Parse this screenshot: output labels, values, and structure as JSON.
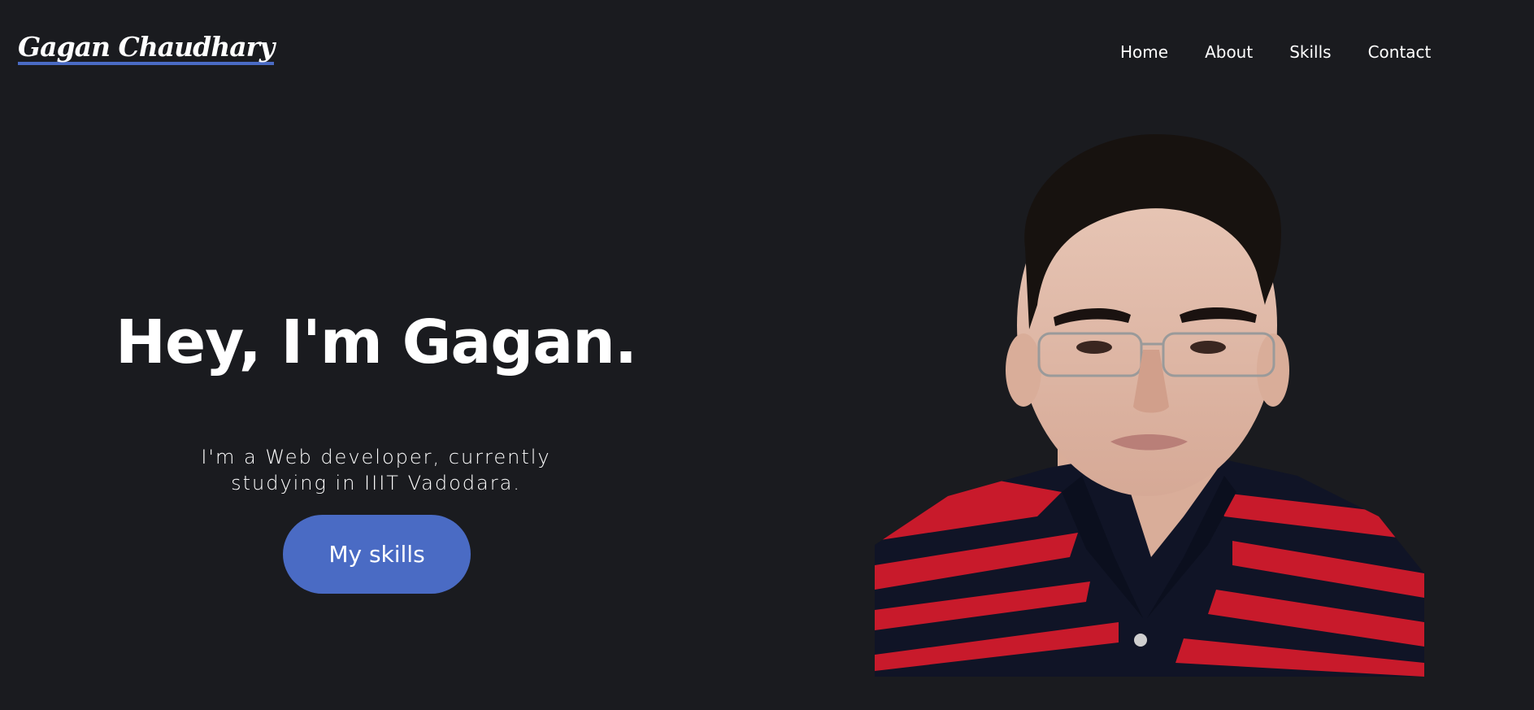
{
  "header": {
    "logo_text": "Gagan Chaudhary",
    "nav": [
      {
        "label": "Home"
      },
      {
        "label": "About"
      },
      {
        "label": "Skills"
      },
      {
        "label": "Contact"
      }
    ]
  },
  "hero": {
    "title": "Hey, I'm Gagan.",
    "subtitle_line1": "I'm a Web developer, currently",
    "subtitle_line2": "studying in IIIT Vadodara.",
    "button_label": "My skills"
  },
  "colors": {
    "background": "#1a1b1f",
    "accent": "#4a6bc4",
    "text": "#ffffff"
  }
}
